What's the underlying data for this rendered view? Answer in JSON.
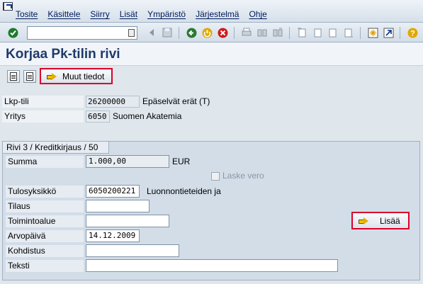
{
  "menu": {
    "items": [
      "Tosite",
      "Käsittele",
      "Siirry",
      "Lisät",
      "Ympäristö",
      "Järjestelmä",
      "Ohje"
    ]
  },
  "toolbar": {
    "command_value": "",
    "icons": [
      "enter-icon",
      "back-icon",
      "exit-icon",
      "cancel-icon",
      "print-icon",
      "find-icon",
      "find-next-icon",
      "first-page-icon",
      "prev-page-icon",
      "next-page-icon",
      "last-page-icon",
      "new-session-icon",
      "shortcut-icon",
      "help-icon"
    ]
  },
  "title": "Korjaa Pk-tilin rivi",
  "app_toolbar": {
    "muut_tiedot": "Muut tiedot"
  },
  "header": {
    "lkp_label": "Lkp-tili",
    "lkp_value": "26200000",
    "lkp_text": "Epäselvät erät (T)",
    "yritys_label": "Yritys",
    "yritys_value": "6050",
    "yritys_text": "Suomen Akatemia"
  },
  "group": {
    "title": "Rivi 3 / Kreditkirjaus / 50",
    "summa_label": "Summa",
    "summa_value": "1.000,00",
    "currency": "EUR",
    "laske_vero": "Laske vero",
    "tulosyksikko_label": "Tulosyksikkö",
    "tulosyksikko_value": "6050200221",
    "tulosyksikko_text": "Luonnontieteiden ja",
    "tilaus_label": "Tilaus",
    "tilaus_value": "",
    "toimintoalue_label": "Toimintoalue",
    "toimintoalue_value": "",
    "arvopaiva_label": "Arvopäivä",
    "arvopaiva_value": "14.12.2009",
    "kohdistus_label": "Kohdistus",
    "kohdistus_value": "",
    "teksti_label": "Teksti",
    "teksti_value": "",
    "lisaa": "Lisää"
  },
  "colors": {
    "highlight_border": "#d9002a",
    "title_text": "#1f3a6b"
  }
}
